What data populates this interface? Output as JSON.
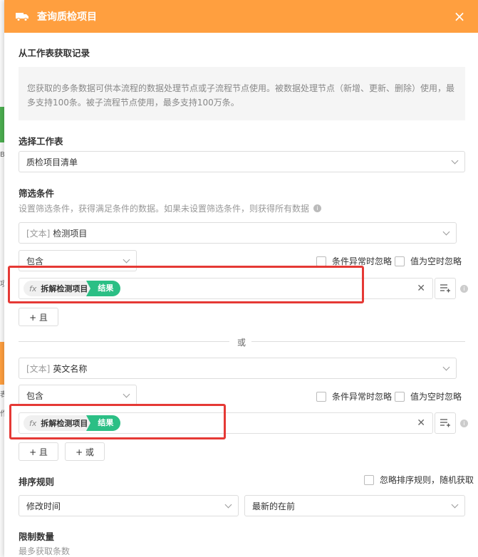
{
  "header": {
    "title": "查询质检项目",
    "close_label": "×"
  },
  "section_source": {
    "title": "从工作表获取记录"
  },
  "note": {
    "text": "您获取的多条数据可供本流程的数据处理节点或子流程节点使用。被数据处理节点（新增、更新、删除）使用，最多支持100条。被子流程节点使用，最多支持100万条。"
  },
  "worksheet": {
    "label": "选择工作表",
    "value": "质检项目清单"
  },
  "filter": {
    "label": "筛选条件",
    "hint": "设置筛选条件，获得满足条件的数据。如果未设置筛选条件，则获得所有数据",
    "groups": [
      {
        "field_tag": "[文本]",
        "field_name": "检测项目",
        "operator": "包含",
        "check_error": "条件异常时忽略",
        "check_empty": "值为空时忽略",
        "expr_fx": "fx",
        "expr_name": "拆解检测项目",
        "expr_result": "结果",
        "add_and": "+ 且"
      },
      {
        "field_tag": "[文本]",
        "field_name": "英文名称",
        "operator": "包含",
        "check_error": "条件异常时忽略",
        "check_empty": "值为空时忽略",
        "expr_fx": "fx",
        "expr_name": "拆解检测项目",
        "expr_result": "结果",
        "add_and": "+ 且",
        "add_or": "+ 或"
      }
    ],
    "or_label": "或"
  },
  "sort": {
    "label": "排序规则",
    "random_label": "忽略排序规则，随机获取",
    "field": "修改时间",
    "order": "最新的在前"
  },
  "limit": {
    "label": "限制数量",
    "hint": "最多获取条数"
  },
  "background": {
    "chars": [
      "B",
      "项",
      "表",
      "作"
    ]
  },
  "colors": {
    "header": "#ff9f3f",
    "result_tag": "#2bbf85",
    "highlight": "#e53935"
  }
}
